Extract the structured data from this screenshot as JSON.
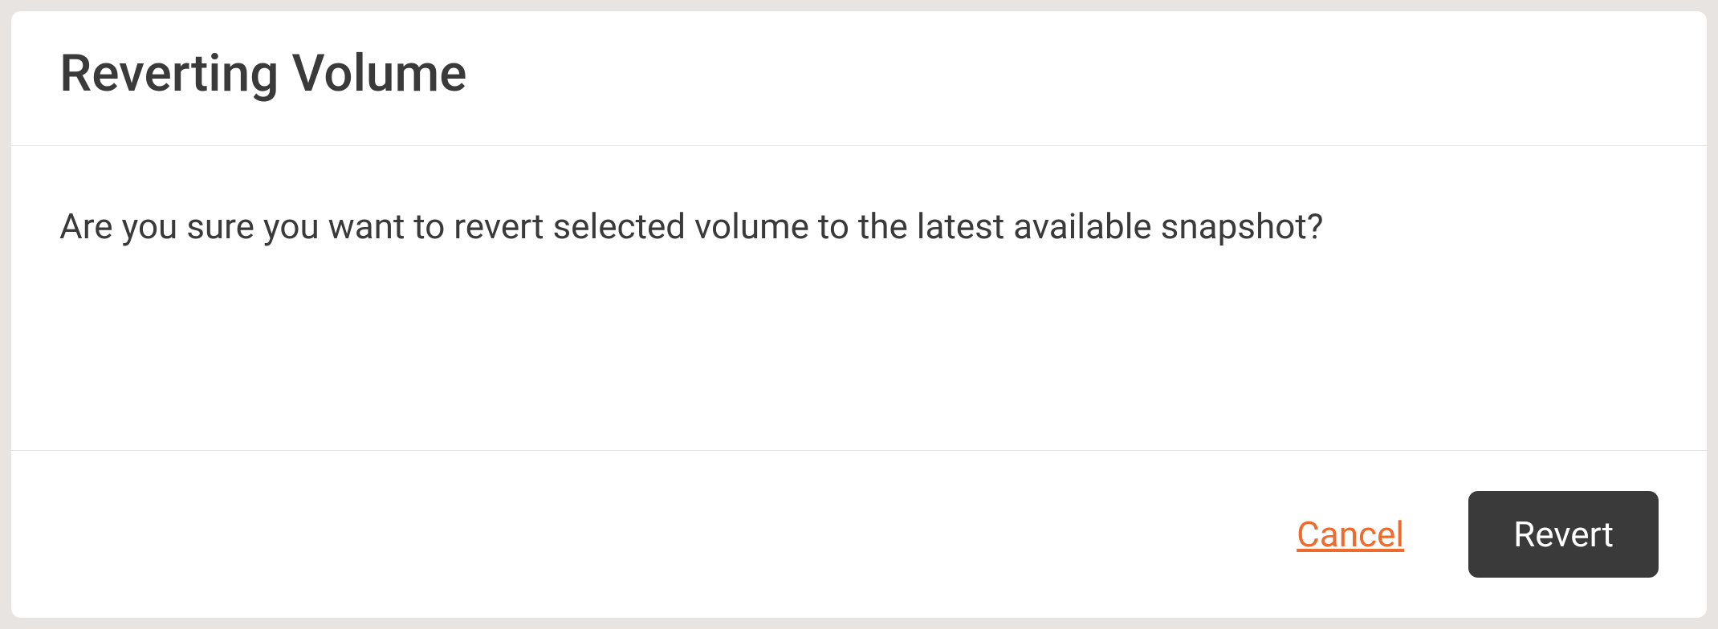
{
  "dialog": {
    "title": "Reverting Volume",
    "message": "Are you sure you want to revert selected volume to the latest available snapshot?",
    "cancel_label": "Cancel",
    "confirm_label": "Revert"
  }
}
